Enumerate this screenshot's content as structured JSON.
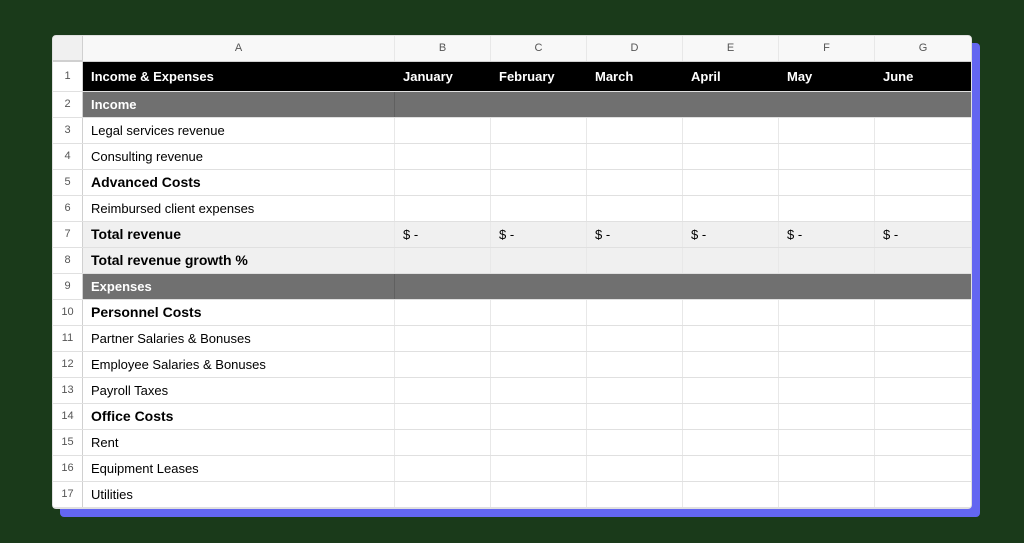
{
  "columns": [
    "A",
    "B",
    "C",
    "D",
    "E",
    "F",
    "G"
  ],
  "header": {
    "title": "Income & Expenses",
    "months": [
      "January",
      "February",
      "March",
      "April",
      "May",
      "June"
    ]
  },
  "empty_dollar": "$  -",
  "rows": [
    {
      "num": 2,
      "type": "section",
      "label": "Income"
    },
    {
      "num": 3,
      "type": "item",
      "label": "Legal services revenue"
    },
    {
      "num": 4,
      "type": "item",
      "label": "Consulting revenue"
    },
    {
      "num": 5,
      "type": "bold",
      "label": "Advanced Costs"
    },
    {
      "num": 6,
      "type": "item",
      "label": "Reimbursed client expenses"
    },
    {
      "num": 7,
      "type": "total",
      "label": "Total revenue",
      "has_dollar": true
    },
    {
      "num": 8,
      "type": "total",
      "label": "Total revenue growth %"
    },
    {
      "num": 9,
      "type": "section",
      "label": "Expenses"
    },
    {
      "num": 10,
      "type": "bold",
      "label": "Personnel Costs"
    },
    {
      "num": 11,
      "type": "item",
      "label": "Partner Salaries & Bonuses"
    },
    {
      "num": 12,
      "type": "item",
      "label": "Employee Salaries & Bonuses"
    },
    {
      "num": 13,
      "type": "item",
      "label": "Payroll Taxes"
    },
    {
      "num": 14,
      "type": "bold",
      "label": "Office Costs"
    },
    {
      "num": 15,
      "type": "item",
      "label": "Rent"
    },
    {
      "num": 16,
      "type": "item",
      "label": "Equipment Leases"
    },
    {
      "num": 17,
      "type": "item",
      "label": "Utilities"
    }
  ]
}
